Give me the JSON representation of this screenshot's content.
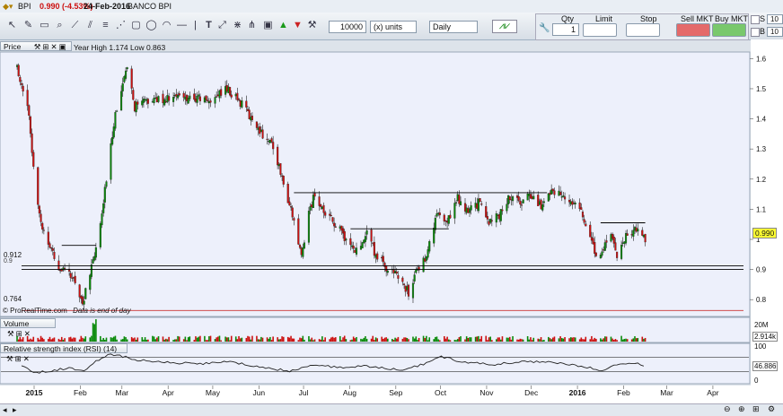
{
  "titlebar": {
    "symbol": "BPI",
    "price_change": "0.990 (-4.53%)",
    "date": "24-Feb-2016",
    "name": "BANCO BPI"
  },
  "toolbar": {
    "quantity_value": "10000",
    "units_select": "(x) units",
    "period_select": "Daily",
    "qty_label": "Qty",
    "qty_value": "1",
    "limit_label": "Limit",
    "stop_label": "Stop",
    "sell_label": "Sell MKT",
    "buy_label": "Buy MKT",
    "s_label": "S",
    "b_label": "B",
    "s_value": "10",
    "b_value": "10"
  },
  "price_panel": {
    "title": "Price",
    "info": "Year High 1.174 Low 0.863",
    "left_labels": {
      "support_a": "0.912",
      "support_b": "0.9",
      "low": "0.764"
    },
    "last_price": "0.990",
    "credit": "© ProRealTime.com",
    "note": "Data is end of day"
  },
  "volume_panel": {
    "title": "Volume",
    "last": "2.914k",
    "scale_top": "20M",
    "scale_bottom": "0"
  },
  "rsi_panel": {
    "title": "Relative strength index (RSI) (14)",
    "last": "46.886",
    "scale_top": "100",
    "scale_bottom": "0"
  },
  "colors": {
    "up": "#0a8a0a",
    "down": "#cc1111",
    "panel_bg": "#edf0fb",
    "accent": "#cc3333"
  },
  "chart_data": [
    {
      "type": "candlestick",
      "title": "BPI",
      "y_ticks": [
        0.8,
        0.9,
        1.0,
        1.1,
        1.2,
        1.3,
        1.4,
        1.5,
        1.6
      ],
      "ylim": [
        0.75,
        1.61
      ],
      "x_ticks": [
        "2015",
        "Feb",
        "Mar",
        "Apr",
        "May",
        "Jun",
        "Jul",
        "Aug",
        "Sep",
        "Oct",
        "Nov",
        "Dec",
        "2016",
        "Feb",
        "Mar",
        "Apr"
      ],
      "x_range": [
        "2015-01-01",
        "2016-04-30"
      ],
      "close_path": [
        [
          "2014-12-29",
          1.57
        ],
        [
          "2015-01-05",
          1.45
        ],
        [
          "2015-01-09",
          1.25
        ],
        [
          "2015-01-14",
          1.05
        ],
        [
          "2015-01-20",
          0.98
        ],
        [
          "2015-01-27",
          0.9
        ],
        [
          "2015-02-02",
          0.88
        ],
        [
          "2015-02-06",
          0.86
        ],
        [
          "2015-02-11",
          0.79
        ],
        [
          "2015-02-16",
          0.88
        ],
        [
          "2015-02-20",
          0.97
        ],
        [
          "2015-02-23",
          1.04
        ],
        [
          "2015-03-02",
          1.32
        ],
        [
          "2015-03-05",
          1.42
        ],
        [
          "2015-03-09",
          1.5
        ],
        [
          "2015-03-13",
          1.56
        ],
        [
          "2015-03-18",
          1.44
        ],
        [
          "2015-03-27",
          1.46
        ],
        [
          "2015-04-10",
          1.47
        ],
        [
          "2015-04-24",
          1.47
        ],
        [
          "2015-05-08",
          1.46
        ],
        [
          "2015-05-18",
          1.5
        ],
        [
          "2015-05-26",
          1.47
        ],
        [
          "2015-06-03",
          1.41
        ],
        [
          "2015-06-12",
          1.35
        ],
        [
          "2015-06-19",
          1.31
        ],
        [
          "2015-06-26",
          1.19
        ],
        [
          "2015-07-03",
          1.06
        ],
        [
          "2015-07-08",
          0.94
        ],
        [
          "2015-07-13",
          1.09
        ],
        [
          "2015-07-17",
          1.15
        ],
        [
          "2015-07-24",
          1.08
        ],
        [
          "2015-07-31",
          1.05
        ],
        [
          "2015-08-07",
          1.0
        ],
        [
          "2015-08-14",
          0.96
        ],
        [
          "2015-08-21",
          1.03
        ],
        [
          "2015-08-26",
          0.96
        ],
        [
          "2015-09-02",
          0.91
        ],
        [
          "2015-09-09",
          0.88
        ],
        [
          "2015-09-14",
          0.86
        ],
        [
          "2015-09-18",
          0.82
        ],
        [
          "2015-09-24",
          0.9
        ],
        [
          "2015-09-30",
          0.95
        ],
        [
          "2015-10-07",
          1.08
        ],
        [
          "2015-10-13",
          1.05
        ],
        [
          "2015-10-21",
          1.14
        ],
        [
          "2015-10-27",
          1.09
        ],
        [
          "2015-11-04",
          1.12
        ],
        [
          "2015-11-11",
          1.06
        ],
        [
          "2015-11-18",
          1.08
        ],
        [
          "2015-11-25",
          1.14
        ],
        [
          "2015-12-02",
          1.12
        ],
        [
          "2015-12-09",
          1.15
        ],
        [
          "2015-12-16",
          1.11
        ],
        [
          "2015-12-22",
          1.16
        ],
        [
          "2015-12-30",
          1.15
        ],
        [
          "2016-01-06",
          1.13
        ],
        [
          "2016-01-12",
          1.09
        ],
        [
          "2016-01-19",
          1.0
        ],
        [
          "2016-01-22",
          0.93
        ],
        [
          "2016-01-27",
          0.98
        ],
        [
          "2016-02-01",
          1.01
        ],
        [
          "2016-02-05",
          0.94
        ],
        [
          "2016-02-10",
          1.0
        ],
        [
          "2016-02-15",
          1.03
        ],
        [
          "2016-02-19",
          1.04
        ],
        [
          "2016-02-24",
          0.99
        ]
      ],
      "lines": [
        {
          "y": 0.912,
          "from": "2015-01-01",
          "to": "2016-04-30",
          "color": "#000"
        },
        {
          "y": 0.9,
          "from": "2015-01-01",
          "to": "2016-04-30",
          "color": "#000"
        },
        {
          "y": 0.764,
          "from": "2015-01-01",
          "to": "2016-04-30",
          "color": "#cc3333"
        },
        {
          "y": 0.98,
          "from": "2015-01-28",
          "to": "2015-02-20",
          "color": "#000"
        },
        {
          "y": 1.155,
          "from": "2015-07-03",
          "to": "2015-12-20",
          "color": "#000"
        },
        {
          "y": 1.035,
          "from": "2015-08-10",
          "to": "2015-10-15",
          "color": "#000"
        },
        {
          "y": 1.055,
          "from": "2016-01-25",
          "to": "2016-02-24",
          "color": "#000"
        }
      ]
    },
    {
      "type": "bar",
      "title": "Volume",
      "y_ticks": [
        "20M",
        "0"
      ],
      "last": "2.914k"
    },
    {
      "type": "line",
      "title": "Relative strength index (RSI) (14)",
      "ylim": [
        0,
        100
      ],
      "reference_lines": [
        70,
        30
      ],
      "path": [
        [
          "2015-01-01",
          45
        ],
        [
          "2015-01-10",
          28
        ],
        [
          "2015-01-20",
          32
        ],
        [
          "2015-02-01",
          40
        ],
        [
          "2015-02-12",
          34
        ],
        [
          "2015-02-20",
          60
        ],
        [
          "2015-03-02",
          78
        ],
        [
          "2015-03-10",
          72
        ],
        [
          "2015-03-20",
          62
        ],
        [
          "2015-04-10",
          55
        ],
        [
          "2015-05-01",
          52
        ],
        [
          "2015-05-20",
          58
        ],
        [
          "2015-06-10",
          42
        ],
        [
          "2015-07-01",
          32
        ],
        [
          "2015-07-15",
          50
        ],
        [
          "2015-08-01",
          42
        ],
        [
          "2015-08-20",
          46
        ],
        [
          "2015-09-15",
          34
        ],
        [
          "2015-10-01",
          55
        ],
        [
          "2015-10-10",
          72
        ],
        [
          "2015-10-25",
          56
        ],
        [
          "2015-11-15",
          50
        ],
        [
          "2015-12-05",
          58
        ],
        [
          "2015-12-25",
          55
        ],
        [
          "2016-01-15",
          44
        ],
        [
          "2016-01-25",
          34
        ],
        [
          "2016-02-05",
          48
        ],
        [
          "2016-02-18",
          54
        ],
        [
          "2016-02-24",
          46.886
        ]
      ]
    }
  ]
}
